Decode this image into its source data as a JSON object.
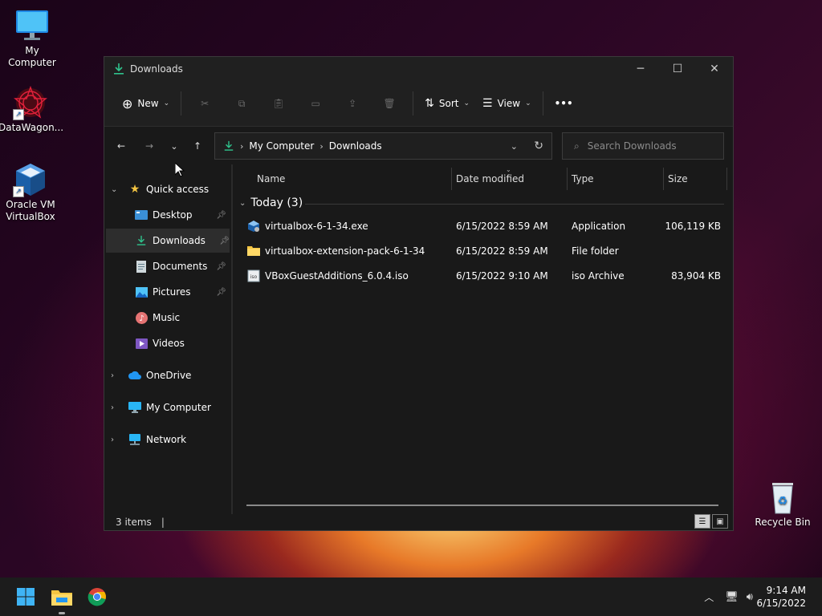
{
  "desktop": {
    "icons": [
      {
        "label": "My Computer",
        "icon": "monitor-icon"
      },
      {
        "label": "DataWagon...",
        "icon": "datawagon-logo-icon"
      },
      {
        "label_line1": "Oracle VM",
        "label_line2": "VirtualBox",
        "icon": "virtualbox-icon"
      },
      {
        "label": "Recycle Bin",
        "icon": "recycle-bin-icon"
      }
    ]
  },
  "window": {
    "title": "Downloads",
    "toolbar": {
      "new_label": "New",
      "sort_label": "Sort",
      "view_label": "View",
      "more_label": "•••"
    },
    "address": {
      "segments": [
        "My Computer",
        "Downloads"
      ]
    },
    "search": {
      "placeholder": "Search Downloads"
    },
    "nav_pane": {
      "quick_access": "Quick access",
      "items": [
        {
          "label": "Desktop",
          "pinned": true
        },
        {
          "label": "Downloads",
          "pinned": true,
          "selected": true
        },
        {
          "label": "Documents",
          "pinned": true
        },
        {
          "label": "Pictures",
          "pinned": true
        },
        {
          "label": "Music"
        },
        {
          "label": "Videos"
        }
      ],
      "roots": [
        {
          "label": "OneDrive"
        },
        {
          "label": "My Computer"
        },
        {
          "label": "Network"
        }
      ]
    },
    "columns": {
      "name": "Name",
      "date": "Date modified",
      "type": "Type",
      "size": "Size"
    },
    "group": {
      "label": "Today (3)"
    },
    "files": [
      {
        "name": "virtualbox-6-1-34.exe",
        "date": "6/15/2022 8:59 AM",
        "type": "Application",
        "size": "106,119 KB",
        "icon": "installer-icon"
      },
      {
        "name": "virtualbox-extension-pack-6-1-34",
        "date": "6/15/2022 8:59 AM",
        "type": "File folder",
        "size": "",
        "icon": "folder-icon"
      },
      {
        "name": "VBoxGuestAdditions_6.0.4.iso",
        "date": "6/15/2022 9:10 AM",
        "type": "iso Archive",
        "size": "83,904 KB",
        "icon": "iso-icon"
      }
    ],
    "status": {
      "item_count": "3 items"
    }
  },
  "taskbar": {
    "time": "9:14 AM",
    "date": "6/15/2022"
  },
  "colors": {
    "accent_green": "#2fc48d",
    "folder_yellow": "#f4c542",
    "window_bg": "#191919"
  }
}
